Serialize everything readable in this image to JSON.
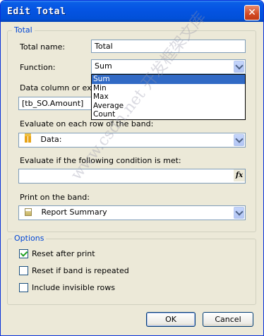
{
  "window": {
    "title": "Edit Total",
    "close_icon": "close-icon"
  },
  "group_total": {
    "label": "Total",
    "total_name_label": "Total name:",
    "total_name_value": "Total",
    "function_label": "Function:",
    "function_value": "Sum",
    "function_options": [
      "Sum",
      "Min",
      "Max",
      "Average",
      "Count"
    ],
    "data_column_label": "Data column or expre",
    "data_column_value": "[tb_SO.Amount]",
    "evaluate_band_label": "Evaluate on each row of the band:",
    "evaluate_band_value": "Data:",
    "evaluate_band_icon": "data-band-icon",
    "condition_label": "Evaluate if the following condition is met:",
    "condition_value": "",
    "condition_button": "fx",
    "print_band_label": "Print on the band:",
    "print_band_value": "Report Summary",
    "print_band_icon": "report-summary-icon"
  },
  "group_options": {
    "label": "Options",
    "reset_after_print": {
      "label": "Reset after print",
      "checked": true
    },
    "reset_if_repeated": {
      "label": "Reset if band is repeated",
      "checked": false
    },
    "include_invisible": {
      "label": "Include invisible rows",
      "checked": false
    }
  },
  "buttons": {
    "ok": "OK",
    "cancel": "Cancel"
  },
  "watermark": "www.csdn.net 开发框架文库",
  "colors": {
    "title_bar": "#0554e3",
    "group_label": "#0046d5",
    "selection": "#316ac5",
    "dialog_bg": "#ece9d8"
  }
}
